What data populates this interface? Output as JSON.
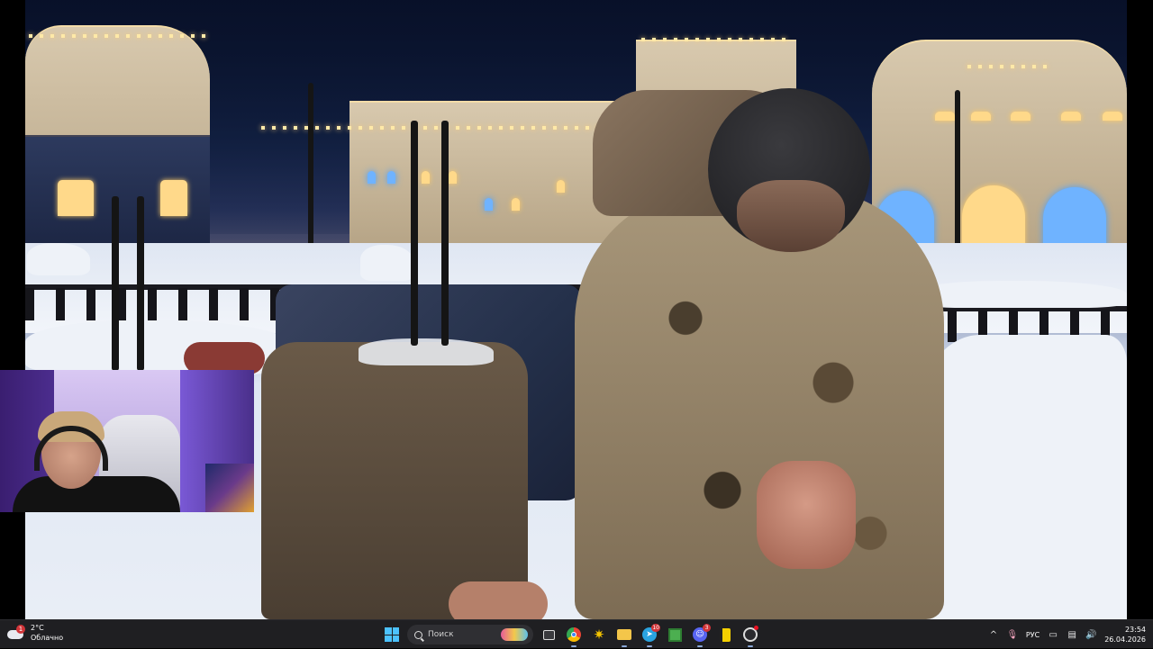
{
  "weather": {
    "temperature": "2°C",
    "condition": "Облачно",
    "badge_count": "1"
  },
  "taskbar": {
    "search_placeholder": "Поиск",
    "apps": [
      {
        "name": "file-explorer-task-view",
        "badge": ""
      },
      {
        "name": "chrome",
        "badge": ""
      },
      {
        "name": "sun-app",
        "badge": ""
      },
      {
        "name": "folder",
        "badge": ""
      },
      {
        "name": "telegram",
        "badge": "10"
      },
      {
        "name": "minecraft",
        "badge": ""
      },
      {
        "name": "discord",
        "badge": "3"
      },
      {
        "name": "yellow-app",
        "badge": ""
      },
      {
        "name": "obs",
        "badge": ""
      }
    ]
  },
  "tray": {
    "language": "РУС",
    "time": "23:54",
    "date": "26.04.2026"
  },
  "colors": {
    "taskbar_bg": "#1f1f22",
    "accent": "#4cc2ff",
    "badge": "#d13438"
  }
}
